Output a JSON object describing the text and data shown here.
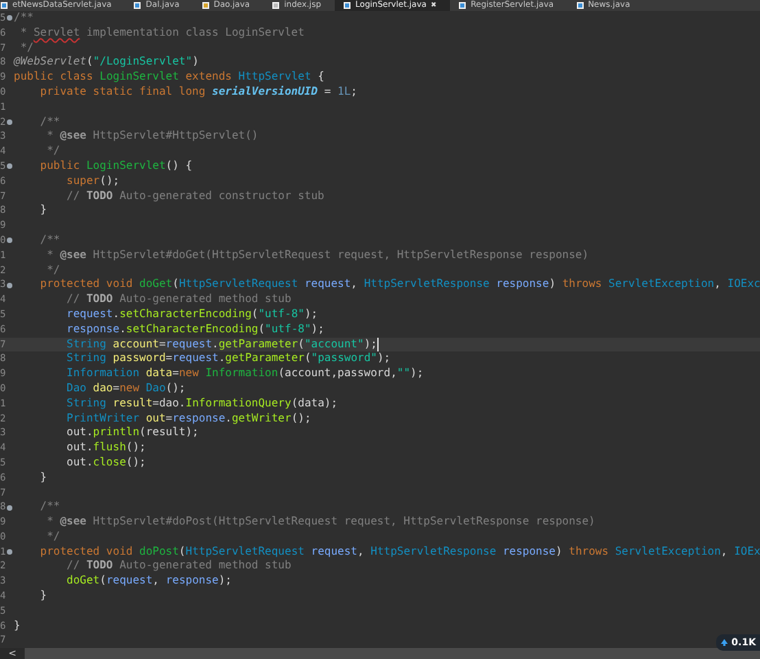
{
  "tabs": [
    {
      "label": "etNewsDataServlet.java",
      "selected": false,
      "kind": "class"
    },
    {
      "label": "Dal.java",
      "selected": false,
      "kind": "class"
    },
    {
      "label": "Dao.java",
      "selected": false,
      "kind": "interface"
    },
    {
      "label": "index.jsp",
      "selected": false,
      "kind": "file"
    },
    {
      "label": "LoginServlet.java",
      "selected": true,
      "kind": "class",
      "close": "✖"
    },
    {
      "label": "RegisterServlet.java",
      "selected": false,
      "kind": "class"
    },
    {
      "label": "News.java",
      "selected": false,
      "kind": "class"
    }
  ],
  "lines": [
    {
      "number": "5",
      "fold": true,
      "current": false,
      "tokens": [
        {
          "kind": "comment",
          "text": "/**"
        }
      ]
    },
    {
      "number": "6",
      "fold": false,
      "current": false,
      "tokens": [
        {
          "kind": "comment",
          "text": " * "
        },
        {
          "kind": "misspelled",
          "text": "Servlet"
        },
        {
          "kind": "comment",
          "text": " implementation class LoginServlet"
        }
      ]
    },
    {
      "number": "7",
      "fold": false,
      "current": false,
      "tokens": [
        {
          "kind": "comment",
          "text": " */"
        }
      ]
    },
    {
      "number": "8",
      "fold": false,
      "current": false,
      "tokens": [
        {
          "kind": "annotation",
          "text": "@WebServlet"
        },
        {
          "kind": "plain",
          "text": "("
        },
        {
          "kind": "string",
          "text": "\"/LoginServlet\""
        },
        {
          "kind": "plain",
          "text": ")"
        }
      ]
    },
    {
      "number": "9",
      "fold": false,
      "current": false,
      "tokens": [
        {
          "kind": "keyword",
          "text": "public class "
        },
        {
          "kind": "declaration",
          "text": "LoginServlet"
        },
        {
          "kind": "keyword",
          "text": " extends "
        },
        {
          "kind": "type",
          "text": "HttpServlet"
        },
        {
          "kind": "plain",
          "text": " {"
        }
      ]
    },
    {
      "number": "0",
      "fold": false,
      "current": false,
      "tokens": [
        {
          "kind": "keyword",
          "text": "    private static final long "
        },
        {
          "kind": "field",
          "text": "serialVersionUID"
        },
        {
          "kind": "plain",
          "text": " = "
        },
        {
          "kind": "number",
          "text": "1L"
        },
        {
          "kind": "plain",
          "text": ";"
        }
      ]
    },
    {
      "number": "1",
      "fold": false,
      "current": false
    },
    {
      "number": "2",
      "fold": true,
      "current": false,
      "tokens": [
        {
          "kind": "comment",
          "text": "    /**"
        }
      ]
    },
    {
      "number": "3",
      "fold": false,
      "current": false,
      "tokens": [
        {
          "kind": "comment",
          "text": "     * "
        },
        {
          "kind": "doctag",
          "text": "@see"
        },
        {
          "kind": "comment",
          "text": " HttpServlet#HttpServlet()"
        }
      ]
    },
    {
      "number": "4",
      "fold": false,
      "current": false,
      "tokens": [
        {
          "kind": "comment",
          "text": "     */"
        }
      ]
    },
    {
      "number": "5",
      "fold": true,
      "current": false,
      "tokens": [
        {
          "kind": "keyword",
          "text": "    public "
        },
        {
          "kind": "declaration",
          "text": "LoginServlet"
        },
        {
          "kind": "plain",
          "text": "() {"
        }
      ]
    },
    {
      "number": "6",
      "fold": false,
      "current": false,
      "tokens": [
        {
          "kind": "keyword",
          "text": "        super"
        },
        {
          "kind": "plain",
          "text": "();"
        }
      ]
    },
    {
      "number": "7",
      "fold": false,
      "current": false,
      "tokens": [
        {
          "kind": "comment",
          "text": "        // "
        },
        {
          "kind": "todo",
          "text": "TODO"
        },
        {
          "kind": "comment",
          "text": " Auto-generated constructor stub"
        }
      ]
    },
    {
      "number": "8",
      "fold": false,
      "current": false,
      "tokens": [
        {
          "kind": "plain",
          "text": "    }"
        }
      ]
    },
    {
      "number": "9",
      "fold": false,
      "current": false
    },
    {
      "number": "0",
      "fold": true,
      "current": false,
      "tokens": [
        {
          "kind": "comment",
          "text": "    /**"
        }
      ]
    },
    {
      "number": "1",
      "fold": false,
      "current": false,
      "tokens": [
        {
          "kind": "comment",
          "text": "     * "
        },
        {
          "kind": "doctag",
          "text": "@see"
        },
        {
          "kind": "comment",
          "text": " HttpServlet#doGet(HttpServletRequest request, HttpServletResponse response)"
        }
      ]
    },
    {
      "number": "2",
      "fold": false,
      "current": false,
      "tokens": [
        {
          "kind": "comment",
          "text": "     */"
        }
      ]
    },
    {
      "number": "3",
      "fold": true,
      "current": false,
      "tokens": [
        {
          "kind": "keyword",
          "text": "    protected void "
        },
        {
          "kind": "declaration",
          "text": "doGet"
        },
        {
          "kind": "plain",
          "text": "("
        },
        {
          "kind": "type",
          "text": "HttpServletRequest"
        },
        {
          "kind": "parameter",
          "text": " request"
        },
        {
          "kind": "plain",
          "text": ", "
        },
        {
          "kind": "type",
          "text": "HttpServletResponse"
        },
        {
          "kind": "parameter",
          "text": " response"
        },
        {
          "kind": "plain",
          "text": ") "
        },
        {
          "kind": "keyword",
          "text": "throws "
        },
        {
          "kind": "type",
          "text": "ServletException"
        },
        {
          "kind": "plain",
          "text": ", "
        },
        {
          "kind": "type",
          "text": "IOExc"
        }
      ]
    },
    {
      "number": "4",
      "fold": false,
      "current": false,
      "tokens": [
        {
          "kind": "comment",
          "text": "        // "
        },
        {
          "kind": "todo",
          "text": "TODO"
        },
        {
          "kind": "comment",
          "text": " Auto-generated method stub"
        }
      ]
    },
    {
      "number": "5",
      "fold": false,
      "current": false,
      "tokens": [
        {
          "kind": "parameter",
          "text": "        request"
        },
        {
          "kind": "plain",
          "text": "."
        },
        {
          "kind": "method",
          "text": "setCharacterEncoding"
        },
        {
          "kind": "plain",
          "text": "("
        },
        {
          "kind": "string",
          "text": "\"utf-8\""
        },
        {
          "kind": "plain",
          "text": ");"
        }
      ]
    },
    {
      "number": "6",
      "fold": false,
      "current": false,
      "tokens": [
        {
          "kind": "parameter",
          "text": "        response"
        },
        {
          "kind": "plain",
          "text": "."
        },
        {
          "kind": "method",
          "text": "setCharacterEncoding"
        },
        {
          "kind": "plain",
          "text": "("
        },
        {
          "kind": "string",
          "text": "\"utf-8\""
        },
        {
          "kind": "plain",
          "text": ");"
        }
      ]
    },
    {
      "number": "7",
      "fold": false,
      "current": true,
      "tokens": [
        {
          "kind": "type",
          "text": "        String"
        },
        {
          "kind": "variable",
          "text": " account"
        },
        {
          "kind": "plain",
          "text": "="
        },
        {
          "kind": "parameter",
          "text": "request"
        },
        {
          "kind": "plain",
          "text": "."
        },
        {
          "kind": "method",
          "text": "getParameter"
        },
        {
          "kind": "plain",
          "text": "("
        },
        {
          "kind": "string",
          "text": "\"account\""
        },
        {
          "kind": "plain",
          "text": ");"
        }
      ]
    },
    {
      "number": "8",
      "fold": false,
      "current": false,
      "tokens": [
        {
          "kind": "type",
          "text": "        String"
        },
        {
          "kind": "variable",
          "text": " password"
        },
        {
          "kind": "plain",
          "text": "="
        },
        {
          "kind": "parameter",
          "text": "request"
        },
        {
          "kind": "plain",
          "text": "."
        },
        {
          "kind": "method",
          "text": "getParameter"
        },
        {
          "kind": "plain",
          "text": "("
        },
        {
          "kind": "string",
          "text": "\"password\""
        },
        {
          "kind": "plain",
          "text": ");"
        }
      ]
    },
    {
      "number": "9",
      "fold": false,
      "current": false,
      "tokens": [
        {
          "kind": "type",
          "text": "        Information"
        },
        {
          "kind": "variable",
          "text": " data"
        },
        {
          "kind": "plain",
          "text": "="
        },
        {
          "kind": "keyword",
          "text": "new "
        },
        {
          "kind": "declaration",
          "text": "Information"
        },
        {
          "kind": "plain",
          "text": "(account,password,"
        },
        {
          "kind": "string",
          "text": "\"\""
        },
        {
          "kind": "plain",
          "text": ");"
        }
      ]
    },
    {
      "number": "0",
      "fold": false,
      "current": false,
      "tokens": [
        {
          "kind": "type",
          "text": "        Dao"
        },
        {
          "kind": "variable",
          "text": " dao"
        },
        {
          "kind": "plain",
          "text": "="
        },
        {
          "kind": "keyword",
          "text": "new "
        },
        {
          "kind": "type",
          "text": "Dao"
        },
        {
          "kind": "plain",
          "text": "();"
        }
      ]
    },
    {
      "number": "1",
      "fold": false,
      "current": false,
      "tokens": [
        {
          "kind": "type",
          "text": "        String"
        },
        {
          "kind": "variable",
          "text": " result"
        },
        {
          "kind": "plain",
          "text": "=dao."
        },
        {
          "kind": "method",
          "text": "InformationQuery"
        },
        {
          "kind": "plain",
          "text": "(data);"
        }
      ]
    },
    {
      "number": "2",
      "fold": false,
      "current": false,
      "tokens": [
        {
          "kind": "type",
          "text": "        PrintWriter"
        },
        {
          "kind": "variable",
          "text": " out"
        },
        {
          "kind": "plain",
          "text": "="
        },
        {
          "kind": "parameter",
          "text": "response"
        },
        {
          "kind": "plain",
          "text": "."
        },
        {
          "kind": "method",
          "text": "getWriter"
        },
        {
          "kind": "plain",
          "text": "();"
        }
      ]
    },
    {
      "number": "3",
      "fold": false,
      "current": false,
      "tokens": [
        {
          "kind": "plain",
          "text": "        out."
        },
        {
          "kind": "method",
          "text": "println"
        },
        {
          "kind": "plain",
          "text": "(result);"
        }
      ]
    },
    {
      "number": "4",
      "fold": false,
      "current": false,
      "tokens": [
        {
          "kind": "plain",
          "text": "        out."
        },
        {
          "kind": "method",
          "text": "flush"
        },
        {
          "kind": "plain",
          "text": "();"
        }
      ]
    },
    {
      "number": "5",
      "fold": false,
      "current": false,
      "tokens": [
        {
          "kind": "plain",
          "text": "        out."
        },
        {
          "kind": "method",
          "text": "close"
        },
        {
          "kind": "plain",
          "text": "();"
        }
      ]
    },
    {
      "number": "6",
      "fold": false,
      "current": false,
      "tokens": [
        {
          "kind": "plain",
          "text": "    }"
        }
      ]
    },
    {
      "number": "7",
      "fold": false,
      "current": false
    },
    {
      "number": "8",
      "fold": true,
      "current": false,
      "tokens": [
        {
          "kind": "comment",
          "text": "    /**"
        }
      ]
    },
    {
      "number": "9",
      "fold": false,
      "current": false,
      "tokens": [
        {
          "kind": "comment",
          "text": "     * "
        },
        {
          "kind": "doctag",
          "text": "@see"
        },
        {
          "kind": "comment",
          "text": " HttpServlet#doPost(HttpServletRequest request, HttpServletResponse response)"
        }
      ]
    },
    {
      "number": "0",
      "fold": false,
      "current": false,
      "tokens": [
        {
          "kind": "comment",
          "text": "     */"
        }
      ]
    },
    {
      "number": "1",
      "fold": true,
      "current": false,
      "tokens": [
        {
          "kind": "keyword",
          "text": "    protected void "
        },
        {
          "kind": "declaration",
          "text": "doPost"
        },
        {
          "kind": "plain",
          "text": "("
        },
        {
          "kind": "type",
          "text": "HttpServletRequest"
        },
        {
          "kind": "parameter",
          "text": " request"
        },
        {
          "kind": "plain",
          "text": ", "
        },
        {
          "kind": "type",
          "text": "HttpServletResponse"
        },
        {
          "kind": "parameter",
          "text": " response"
        },
        {
          "kind": "plain",
          "text": ") "
        },
        {
          "kind": "keyword",
          "text": "throws "
        },
        {
          "kind": "type",
          "text": "ServletException"
        },
        {
          "kind": "plain",
          "text": ", "
        },
        {
          "kind": "type",
          "text": "IOEx"
        }
      ]
    },
    {
      "number": "2",
      "fold": false,
      "current": false,
      "tokens": [
        {
          "kind": "comment",
          "text": "        // "
        },
        {
          "kind": "todo",
          "text": "TODO"
        },
        {
          "kind": "comment",
          "text": " Auto-generated method stub"
        }
      ]
    },
    {
      "number": "3",
      "fold": false,
      "current": false,
      "tokens": [
        {
          "kind": "method",
          "text": "        doGet"
        },
        {
          "kind": "plain",
          "text": "("
        },
        {
          "kind": "parameter",
          "text": "request"
        },
        {
          "kind": "plain",
          "text": ", "
        },
        {
          "kind": "parameter",
          "text": "response"
        },
        {
          "kind": "plain",
          "text": ");"
        }
      ]
    },
    {
      "number": "4",
      "fold": false,
      "current": false,
      "tokens": [
        {
          "kind": "plain",
          "text": "    }"
        }
      ]
    },
    {
      "number": "5",
      "fold": false,
      "current": false
    },
    {
      "number": "6",
      "fold": false,
      "current": false,
      "tokens": [
        {
          "kind": "plain",
          "text": "}"
        }
      ]
    },
    {
      "number": "7",
      "fold": false,
      "current": false
    }
  ],
  "scrollbar": {
    "arrow": "<"
  },
  "network_badge": {
    "upload": "0.1K"
  }
}
